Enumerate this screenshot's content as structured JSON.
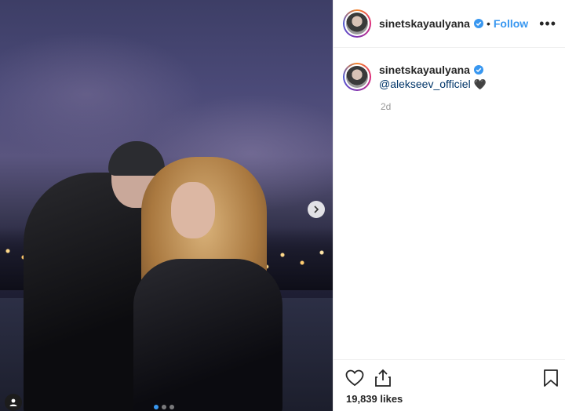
{
  "post": {
    "username": "sinetskayaulyana",
    "follow_label": "Follow",
    "separator": "•",
    "more_label": "•••"
  },
  "caption": {
    "username": "sinetskayaulyana",
    "mention": "@alekseev_officiel",
    "emoji": "🖤",
    "time": "2d"
  },
  "stats": {
    "likes": "19,839 likes"
  },
  "carousel": {
    "total": 3,
    "active_index": 0
  },
  "colors": {
    "accent": "#3897f0",
    "text": "#262626",
    "muted": "#999999"
  }
}
